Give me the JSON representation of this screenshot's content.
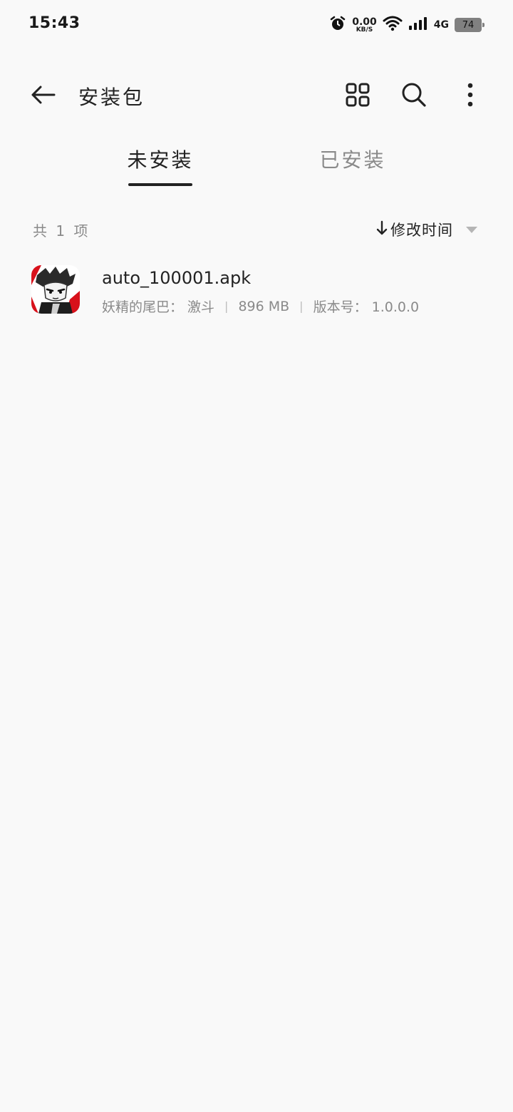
{
  "status_bar": {
    "time": "15:43",
    "net_speed_value": "0.00",
    "net_speed_unit": "KB/S",
    "network_type": "4G",
    "battery": "74"
  },
  "toolbar": {
    "title": "安装包",
    "icons": [
      "back-arrow-icon",
      "grid-view-icon",
      "search-icon",
      "more-vert-icon"
    ]
  },
  "tabs": [
    {
      "label": "未安装",
      "active": true
    },
    {
      "label": "已安装",
      "active": false
    }
  ],
  "list_header": {
    "count": "共 1 项",
    "sort_label": "修改时间"
  },
  "files": [
    {
      "name": "auto_100001.apk",
      "source": "妖精的尾巴： 激斗",
      "size": "896 MB",
      "version": "版本号： 1.0.0.0"
    }
  ],
  "colors": {
    "background": "#f9f9f9",
    "text_primary": "#222222",
    "text_secondary": "#8a8a8a",
    "battery": "#808080"
  }
}
